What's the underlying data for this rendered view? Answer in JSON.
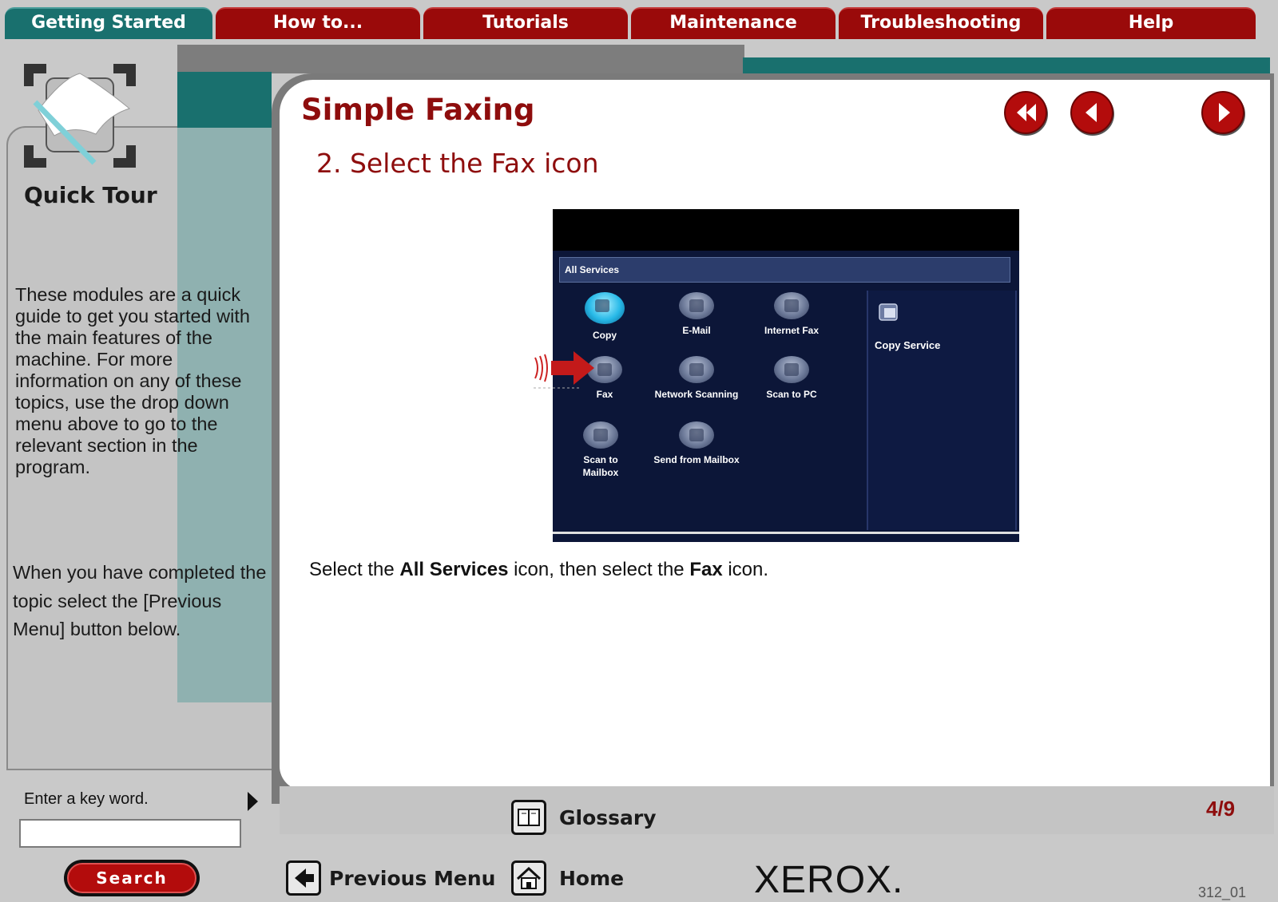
{
  "tabs": [
    {
      "label": "Getting Started",
      "active": true
    },
    {
      "label": "How to...",
      "active": false
    },
    {
      "label": "Tutorials",
      "active": false
    },
    {
      "label": "Maintenance",
      "active": false
    },
    {
      "label": "Troubleshooting",
      "active": false
    },
    {
      "label": "Help",
      "active": false
    }
  ],
  "sidebar": {
    "title": "Quick Tour",
    "description": "These modules are a quick guide to get you started with the main features of the machine. For more information on any of these topics, use the drop down menu above to go to the relevant section in the program.",
    "completion_note": "When you have completed the topic select the [Previous Menu] button below.",
    "keyword_label": "Enter a key word.",
    "keyword_value": "",
    "search_label": "Search"
  },
  "main": {
    "title": "Simple Faxing",
    "step": "2. Select the Fax icon",
    "instruction": {
      "part1": "Select the ",
      "bold1": "All Services",
      "part2": " icon, then select the ",
      "bold2": "Fax",
      "part3": " icon."
    },
    "nav": {
      "first": "first-page",
      "back": "previous-page",
      "next": "next-page"
    }
  },
  "device_screen": {
    "header": "All Services",
    "services": [
      "Copy",
      "E-Mail",
      "Internet Fax",
      "Fax",
      "Network Scanning",
      "Scan to PC",
      "Scan to Mailbox",
      "Send from Mailbox"
    ],
    "side_item": "Copy Service"
  },
  "footer": {
    "page_indicator": "4/9",
    "glossary": "Glossary",
    "previous_menu": "Previous Menu",
    "home": "Home",
    "brand": "XEROX.",
    "code": "312_01"
  },
  "colors": {
    "accent_red": "#8e0d0d",
    "tab_red": "#9a0a0a",
    "tab_teal": "#19706e"
  }
}
